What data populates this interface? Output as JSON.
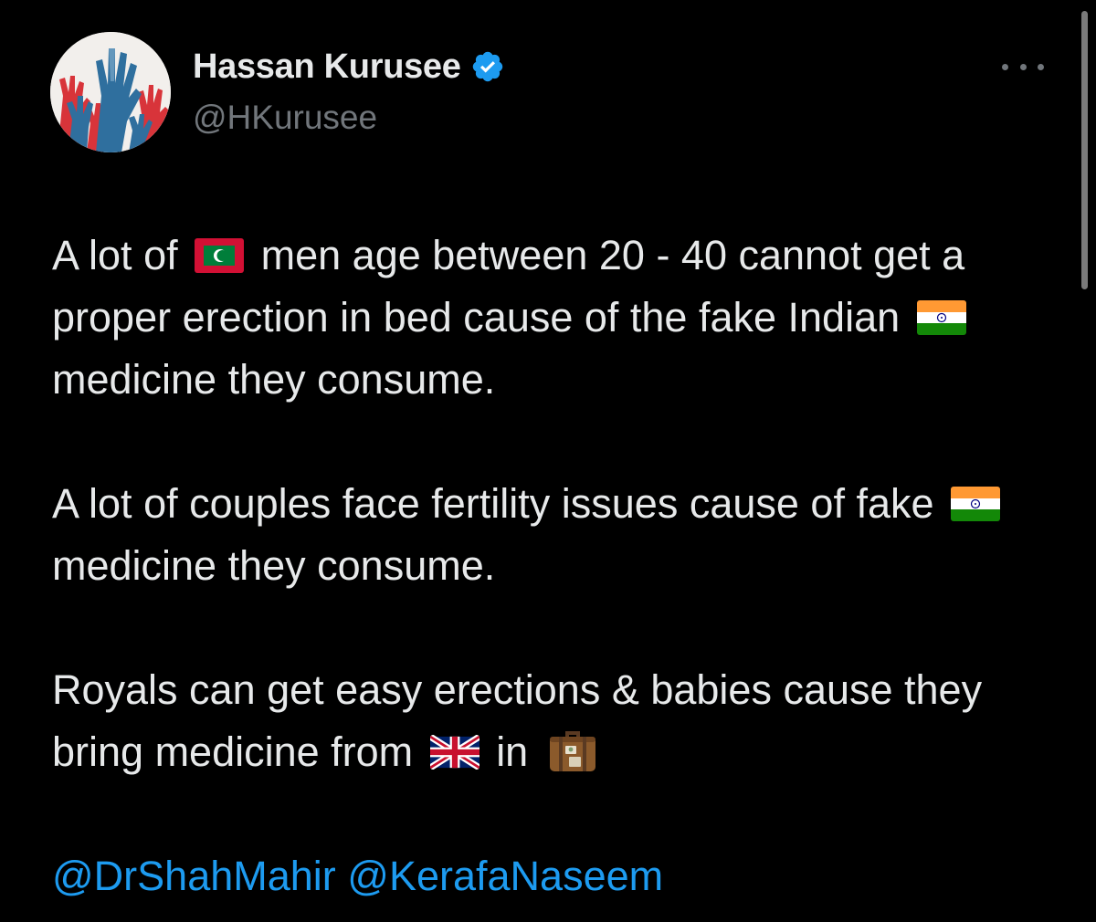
{
  "author": {
    "display_name": "Hassan Kurusee",
    "handle": "@HKurusee",
    "verified": true,
    "avatar_icon": "raised-hands-avatar"
  },
  "more_menu_icon": "ellipsis-icon",
  "tweet": {
    "para1": {
      "part1": "A lot of",
      "flag1": "maldives-flag-icon",
      "part2": "men age between 20 - 40 cannot get a proper erection in bed cause of the fake Indian",
      "flag2": "india-flag-icon",
      "part3": "medicine they consume."
    },
    "para2": {
      "part1": "A lot of couples face fertility issues cause of fake",
      "flag1": "india-flag-icon",
      "part2": "medicine they consume."
    },
    "para3": {
      "part1": "Royals can get easy erections & babies cause they bring medicine from",
      "flag1": "uk-flag-icon",
      "part2": "in",
      "icon2": "suitcase-icon"
    },
    "mentions": [
      "@DrShahMahir",
      "@KerafaNaseem"
    ]
  },
  "colors": {
    "background": "#000000",
    "text": "#e7e9ea",
    "secondary_text": "#71767b",
    "link": "#1d9bf0",
    "verified_badge": "#1d9bf0"
  }
}
